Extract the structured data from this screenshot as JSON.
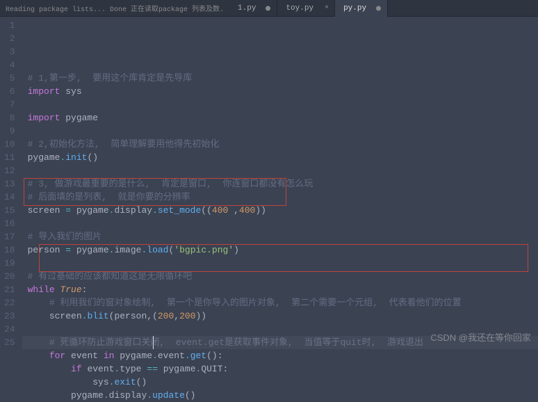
{
  "tabs": {
    "status_msg": "Reading package lists... Done   正在读取package 列表及数.",
    "items": [
      {
        "label": "1.py",
        "active": false,
        "dirty": true
      },
      {
        "label": "toy.py",
        "active": false,
        "dirty": false
      },
      {
        "label": "py.py",
        "active": true,
        "dirty": true
      }
    ]
  },
  "code": {
    "lines": [
      {
        "n": "1",
        "seg": [
          {
            "c": "c-cmt",
            "t": "# 1,第一步,  要用这个库肯定是先导库"
          }
        ]
      },
      {
        "n": "2",
        "seg": [
          {
            "c": "c-kw",
            "t": "import"
          },
          {
            "c": "c-pl",
            "t": " sys"
          }
        ]
      },
      {
        "n": "3",
        "seg": []
      },
      {
        "n": "4",
        "seg": [
          {
            "c": "c-kw",
            "t": "import"
          },
          {
            "c": "c-pl",
            "t": " pygame"
          }
        ]
      },
      {
        "n": "5",
        "seg": []
      },
      {
        "n": "6",
        "seg": [
          {
            "c": "c-cmt",
            "t": "# 2,初始化方法,  简单理解要用他得先初始化"
          }
        ]
      },
      {
        "n": "7",
        "seg": [
          {
            "c": "c-pl",
            "t": "pygame"
          },
          {
            "c": "c-op",
            "t": "."
          },
          {
            "c": "c-fn",
            "t": "init"
          },
          {
            "c": "c-pl",
            "t": "()"
          }
        ]
      },
      {
        "n": "8",
        "seg": []
      },
      {
        "n": "9",
        "seg": [
          {
            "c": "c-cmt",
            "t": "# 3, 做游戏最重要的是什么,  肯定是窗口,  你连窗口都没有怎么玩"
          }
        ]
      },
      {
        "n": "10",
        "seg": [
          {
            "c": "c-cmt",
            "t": "# 后面填的是列表,  就是你要的分辨率"
          }
        ]
      },
      {
        "n": "11",
        "seg": [
          {
            "c": "c-pl",
            "t": "screen "
          },
          {
            "c": "c-op",
            "t": "="
          },
          {
            "c": "c-pl",
            "t": " pygame"
          },
          {
            "c": "c-op",
            "t": "."
          },
          {
            "c": "c-pl",
            "t": "display"
          },
          {
            "c": "c-op",
            "t": "."
          },
          {
            "c": "c-fn",
            "t": "set_mode"
          },
          {
            "c": "c-pl",
            "t": "(("
          },
          {
            "c": "c-num",
            "t": "400"
          },
          {
            "c": "c-pl",
            "t": " ,"
          },
          {
            "c": "c-num",
            "t": "400"
          },
          {
            "c": "c-pl",
            "t": "))"
          }
        ]
      },
      {
        "n": "12",
        "seg": []
      },
      {
        "n": "13",
        "seg": [
          {
            "c": "c-cmt",
            "t": "# 导入我们的图片"
          }
        ]
      },
      {
        "n": "14",
        "seg": [
          {
            "c": "c-pl",
            "t": "person "
          },
          {
            "c": "c-op",
            "t": "="
          },
          {
            "c": "c-pl",
            "t": " pygame"
          },
          {
            "c": "c-op",
            "t": "."
          },
          {
            "c": "c-pl",
            "t": "image"
          },
          {
            "c": "c-op",
            "t": "."
          },
          {
            "c": "c-fn",
            "t": "load"
          },
          {
            "c": "c-pl",
            "t": "("
          },
          {
            "c": "c-str",
            "t": "'bgpic.png'"
          },
          {
            "c": "c-pl",
            "t": ")"
          }
        ]
      },
      {
        "n": "15",
        "seg": []
      },
      {
        "n": "16",
        "seg": [
          {
            "c": "c-cmt",
            "t": "# 有过基础的应该都知道这是无限循环吧"
          }
        ]
      },
      {
        "n": "17",
        "seg": [
          {
            "c": "c-kw",
            "t": "while"
          },
          {
            "c": "c-pl",
            "t": " "
          },
          {
            "c": "c-id",
            "t": "True"
          },
          {
            "c": "c-pl",
            "t": ":"
          }
        ]
      },
      {
        "n": "18",
        "seg": [
          {
            "c": "c-pl",
            "t": "    "
          },
          {
            "c": "c-cmt",
            "t": "# 利用我们的窗对象绘制,  第一个是你导入的图片对象,  第二个需要一个元组,  代表着他们的位置"
          }
        ]
      },
      {
        "n": "19",
        "seg": [
          {
            "c": "c-pl",
            "t": "    screen"
          },
          {
            "c": "c-op",
            "t": "."
          },
          {
            "c": "c-fn",
            "t": "blit"
          },
          {
            "c": "c-pl",
            "t": "(person,("
          },
          {
            "c": "c-num",
            "t": "200"
          },
          {
            "c": "c-pl",
            "t": ","
          },
          {
            "c": "c-num",
            "t": "200"
          },
          {
            "c": "c-pl",
            "t": "))"
          }
        ]
      },
      {
        "n": "20",
        "seg": []
      },
      {
        "n": "21",
        "seg": [
          {
            "c": "c-pl",
            "t": "    "
          },
          {
            "c": "c-cmt",
            "t": "# 死循环防止游戏窗口关闭,  event.get是获取事件对象,  当值等于quit时,  游戏退出"
          }
        ]
      },
      {
        "n": "22",
        "seg": [
          {
            "c": "c-pl",
            "t": "    "
          },
          {
            "c": "c-kw",
            "t": "for"
          },
          {
            "c": "c-pl",
            "t": " event "
          },
          {
            "c": "c-kw",
            "t": "in"
          },
          {
            "c": "c-pl",
            "t": " pygame"
          },
          {
            "c": "c-op",
            "t": "."
          },
          {
            "c": "c-pl",
            "t": "event"
          },
          {
            "c": "c-op",
            "t": "."
          },
          {
            "c": "c-fn",
            "t": "get"
          },
          {
            "c": "c-pl",
            "t": "():"
          }
        ]
      },
      {
        "n": "23",
        "seg": [
          {
            "c": "c-pl",
            "t": "        "
          },
          {
            "c": "c-kw",
            "t": "if"
          },
          {
            "c": "c-pl",
            "t": " event"
          },
          {
            "c": "c-op",
            "t": "."
          },
          {
            "c": "c-pl",
            "t": "type "
          },
          {
            "c": "c-op",
            "t": "=="
          },
          {
            "c": "c-pl",
            "t": " pygame"
          },
          {
            "c": "c-op",
            "t": "."
          },
          {
            "c": "c-pl",
            "t": "QUIT:"
          }
        ]
      },
      {
        "n": "24",
        "seg": [
          {
            "c": "c-pl",
            "t": "            sys"
          },
          {
            "c": "c-op",
            "t": "."
          },
          {
            "c": "c-fn",
            "t": "exit"
          },
          {
            "c": "c-pl",
            "t": "()"
          }
        ]
      },
      {
        "n": "25",
        "seg": [
          {
            "c": "c-pl",
            "t": "        pygame"
          },
          {
            "c": "c-op",
            "t": "."
          },
          {
            "c": "c-pl",
            "t": "display"
          },
          {
            "c": "c-op",
            "t": "."
          },
          {
            "c": "c-fn",
            "t": "update"
          },
          {
            "c": "c-pl",
            "t": "()"
          }
        ]
      }
    ]
  },
  "watermark": "CSDN @我还在等你回家"
}
